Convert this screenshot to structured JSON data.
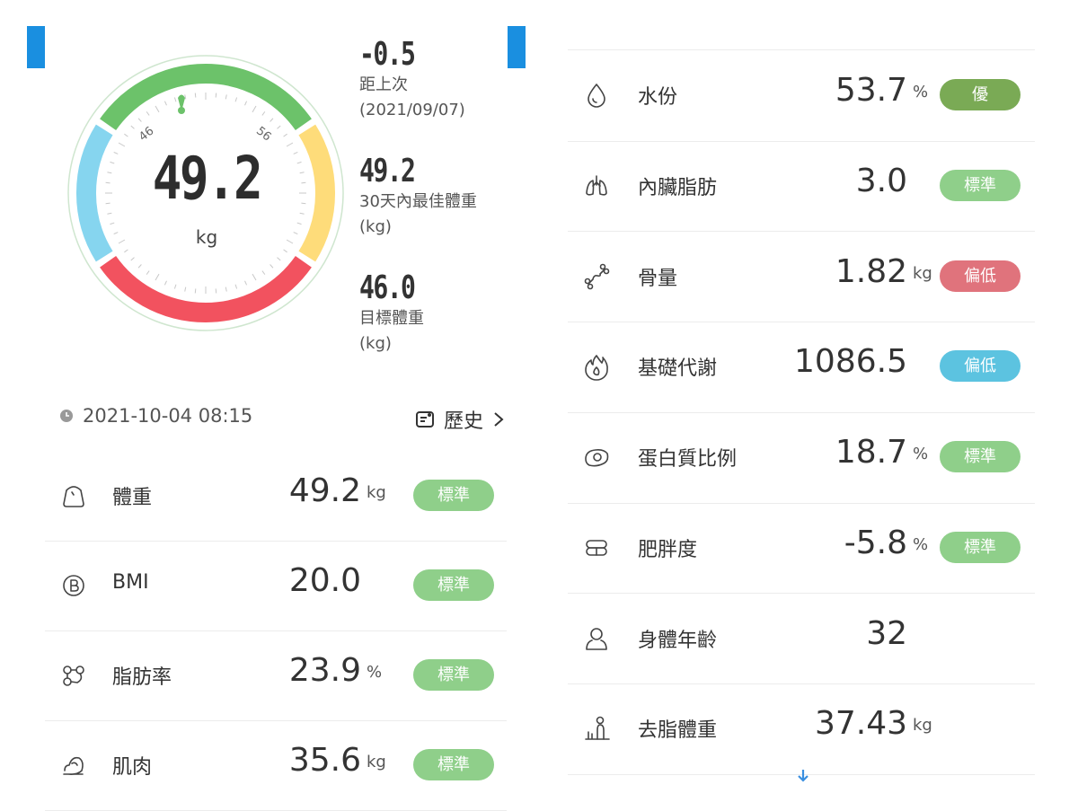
{
  "gauge": {
    "weight": "49.2",
    "unit": "kg",
    "tick_low": "46",
    "tick_high": "56"
  },
  "stats": [
    {
      "value": "-0.5",
      "label_line1": "距上次",
      "label_line2": "(2021/09/07)"
    },
    {
      "value": "49.2",
      "label_line1": "30天內最佳體重",
      "label_line2": "(kg)"
    },
    {
      "value": "46.0",
      "label_line1": "目標體重",
      "label_line2": "(kg)"
    }
  ],
  "timestamp": "2021-10-04 08:15",
  "history_label": "歷史",
  "colors": {
    "accent": "#1a8fe0",
    "gauge_green": "#6cc26a",
    "gauge_yellow": "#fedc7a",
    "gauge_red": "#f2525f",
    "gauge_blue": "#86d5ef",
    "badge_standard": "#8fcf8a",
    "badge_excellent": "#7aaa55",
    "badge_low_red": "#e0737c",
    "badge_low_blue": "#5cc3e0"
  },
  "left_metrics": [
    {
      "icon": "weight-icon",
      "name": "體重",
      "value": "49.2",
      "unit": "kg",
      "badge": "標準"
    },
    {
      "icon": "bmi-icon",
      "name": "BMI",
      "value": "20.0",
      "unit": "",
      "badge": "標準"
    },
    {
      "icon": "body-fat-icon",
      "name": "脂肪率",
      "value": "23.9",
      "unit": "%",
      "badge": "標準"
    },
    {
      "icon": "muscle-icon",
      "name": "肌肉",
      "value": "35.6",
      "unit": "kg",
      "badge": "標準"
    }
  ],
  "right_metrics": [
    {
      "icon": "water-drop-icon",
      "name": "水份",
      "value": "53.7",
      "unit": "%",
      "badge": "優"
    },
    {
      "icon": "lungs-icon",
      "name": "內臟脂肪",
      "value": "3.0",
      "unit": "",
      "badge": "標準"
    },
    {
      "icon": "bone-icon",
      "name": "骨量",
      "value": "1.82",
      "unit": "kg",
      "badge": "偏低"
    },
    {
      "icon": "flame-icon",
      "name": "基礎代謝",
      "value": "1086.5",
      "unit": "",
      "badge": "偏低"
    },
    {
      "icon": "protein-icon",
      "name": "蛋白質比例",
      "value": "18.7",
      "unit": "%",
      "badge": "標準"
    },
    {
      "icon": "obesity-icon",
      "name": "肥胖度",
      "value": "-5.8",
      "unit": "%",
      "badge": "標準"
    },
    {
      "icon": "body-age-icon",
      "name": "身體年齡",
      "value": "32",
      "unit": "",
      "badge": ""
    },
    {
      "icon": "lean-mass-icon",
      "name": "去脂體重",
      "value": "37.43",
      "unit": "kg",
      "badge": ""
    }
  ]
}
